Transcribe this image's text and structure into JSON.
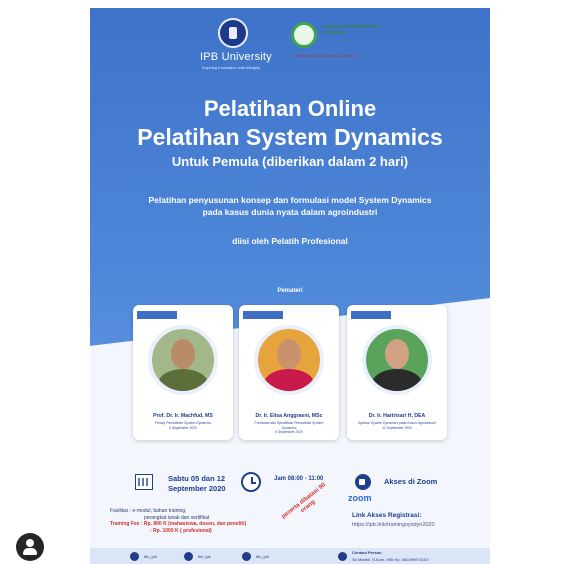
{
  "colors": {
    "poster_blue": "#3f73c9",
    "accent_dark": "#1f3e8c",
    "warning_red": "#d0312d",
    "zoom_blue": "#2d66d8"
  },
  "header": {
    "ipb_name": "IPB University",
    "ipb_tagline": "Inspiring Innovation with Integrity",
    "association_name": "ASOSIASI AGROINDUSTRI INDONESIA",
    "association_tagline": "Professional Agroindustry Association"
  },
  "title": {
    "line1": "Pelatihan Online",
    "line2": "Pelatihan System Dynamics",
    "line3": "Untuk Pemula (diberikan dalam 2 hari)"
  },
  "description": {
    "line1": "Pelatihan penyusunan konsep dan formulasi model System Dynamics",
    "line2": "pada kasus dunia nyata dalam agroindustri",
    "byline": "diisi oleh Pelatih Profesional"
  },
  "speakers_label": "Pemateri",
  "speakers": [
    {
      "name": "Prof. Dr. Ir. Machfud, MS",
      "topic": "Prinsip Pemodelan System Dynamics",
      "date": "5 September 2020",
      "icon": "speaker-photo"
    },
    {
      "name": "Dr. Ir. Elisa Anggraeni, MSc",
      "topic": "Formulasi dan Spesifikasi Pemodelan System Dynamics",
      "date": "5 September 2020",
      "icon": "speaker-photo"
    },
    {
      "name": "Dr. Ir. Hartrisari H, DEA",
      "topic": "Aplikasi System Dynamics pada Kasus Agroindustri",
      "date": "12 September 2020",
      "icon": "speaker-photo"
    }
  ],
  "schedule": {
    "date_line1": "Sabtu 05 dan 12",
    "date_line2": "September 2020",
    "time": "Jam 08:00 - 11:00",
    "platform": "Akses di Zoom",
    "platform_logo": "zoom"
  },
  "fees": {
    "facilities_line1": "Fasilitas : e-modul, bahan training,",
    "facilities_line2": "perangkat lunak dan sertifikat",
    "fee_line1": "Training Fee : Rp. 800 K (mahasiswa, dosen, dan peneliti)",
    "fee_line2": ": Rp. 1000 K ( profesional)",
    "limit_stamp": "peserta dibatasi 90 orang"
  },
  "registration": {
    "label": "Link Akses Registrasi:",
    "url": "https://ipb.link/trainingsysdyn2020"
  },
  "footer": {
    "social1": "ftin_ipb",
    "social2": "ftin_ipb",
    "social3": "ftin_ipb",
    "contact_label": "Contact Person",
    "contact_value": "Sri Martini, S.Kom, MSi   Hp. 081599970103"
  }
}
